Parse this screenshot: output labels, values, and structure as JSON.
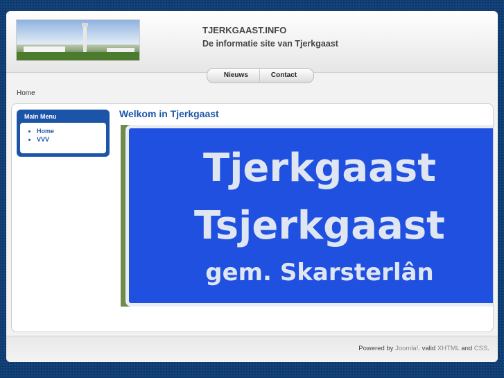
{
  "header": {
    "title": "TJERKGAAST.INFO",
    "slogan": "De informatie site van Tjerkgaast"
  },
  "nav": {
    "items": [
      "Nieuws",
      "Contact"
    ]
  },
  "breadcrumb": "Home",
  "menu": {
    "title": "Main Menu",
    "items": [
      "Home",
      "VVV"
    ]
  },
  "article": {
    "title": "Welkom in Tjerkgaast",
    "sign_lines": [
      "Tjerkgaast",
      "Tsjerkgaast",
      "gem. Skarsterlân"
    ]
  },
  "footer": {
    "powered": "Powered by",
    "joomla": "Joomla!",
    "valid": ". valid",
    "xhtml": "XHTML",
    "and": "and",
    "css": "CSS",
    "end": "."
  },
  "colors": {
    "accent": "#1c55a8",
    "background": "#0f3a6e"
  }
}
